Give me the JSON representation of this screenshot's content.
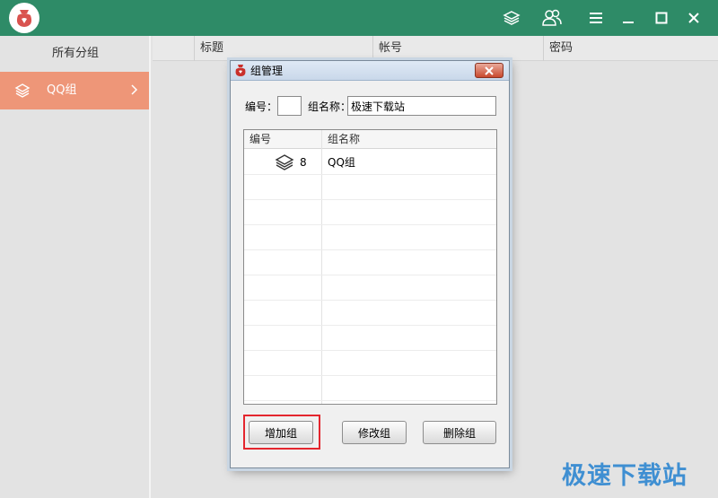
{
  "window": {
    "titlebar_icons": [
      "layers-icon",
      "users-icon",
      "menu-icon",
      "minimize-icon",
      "maximize-icon",
      "close-icon"
    ]
  },
  "sidebar": {
    "header": "所有分组",
    "items": [
      {
        "label": "QQ组",
        "icon": "layers-icon",
        "selected": true
      }
    ]
  },
  "main": {
    "columns": [
      "标题",
      "帐号",
      "密码"
    ]
  },
  "dialog": {
    "title": "组管理",
    "id_label": "编号：",
    "id_value": "",
    "name_label": "组名称：",
    "name_value": "极速下载站",
    "list": {
      "headers": [
        "编号",
        "组名称"
      ],
      "rows": [
        {
          "id": "8",
          "name": "QQ组",
          "icon": "layers-icon"
        }
      ]
    },
    "buttons": {
      "add": "增加组",
      "modify": "修改组",
      "delete": "删除组"
    }
  },
  "watermark": "极速下载站",
  "colors": {
    "titlebar": "#2e8b67",
    "selected_item": "#ee9678",
    "highlight": "#e4262e",
    "watermark": "#3f8fd2"
  }
}
